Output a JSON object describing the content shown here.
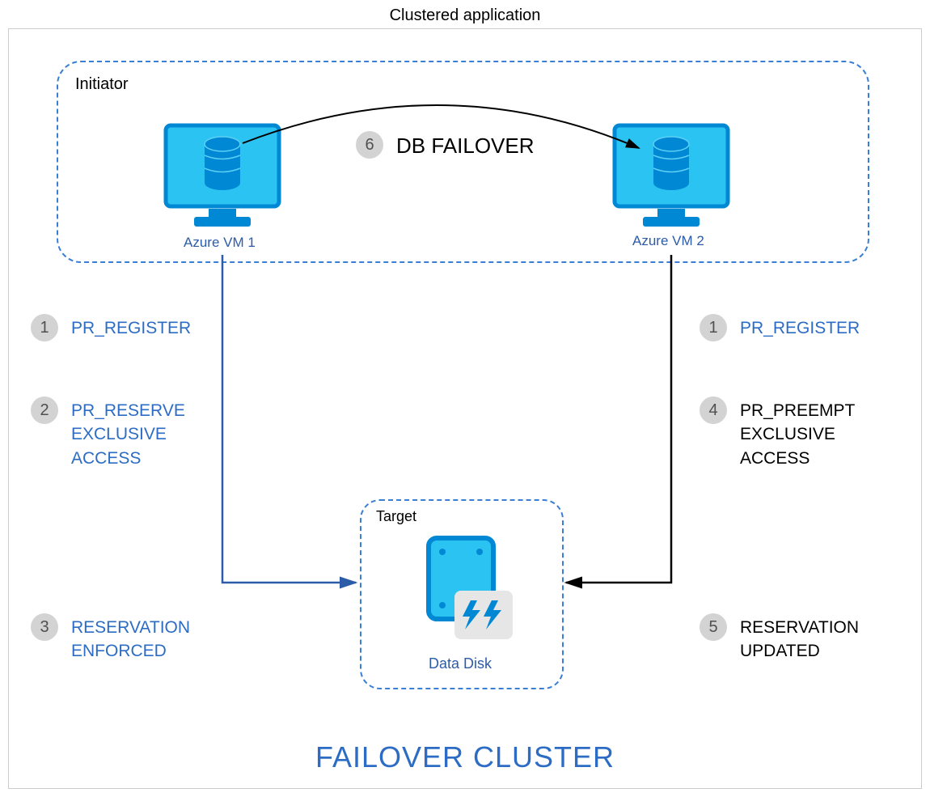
{
  "title": "Clustered application",
  "initiator": {
    "label": "Initiator"
  },
  "vm1": {
    "label": "Azure VM 1"
  },
  "vm2": {
    "label": "Azure VM 2"
  },
  "target": {
    "label": "Target",
    "disk_label": "Data Disk"
  },
  "failover_title": "FAILOVER CLUSTER",
  "db_failover": "DB FAILOVER",
  "steps": {
    "left": {
      "s1": {
        "num": "1",
        "text": "PR_REGISTER"
      },
      "s2": {
        "num": "2",
        "text": "PR_RESERVE\nEXCLUSIVE\nACCESS"
      },
      "s3": {
        "num": "3",
        "text": "RESERVATION\nENFORCED"
      }
    },
    "right": {
      "s1": {
        "num": "1",
        "text": "PR_REGISTER"
      },
      "s4": {
        "num": "4",
        "text": "PR_PREEMPT\nEXCLUSIVE\nACCESS"
      },
      "s5": {
        "num": "5",
        "text": "RESERVATION\nUPDATED"
      }
    },
    "top": {
      "s6": {
        "num": "6"
      }
    }
  },
  "colors": {
    "azure_blue": "#0088d4",
    "light_blue": "#2bc3f2",
    "dashed_blue": "#3a7fd6",
    "text_blue": "#2c6cc4"
  }
}
